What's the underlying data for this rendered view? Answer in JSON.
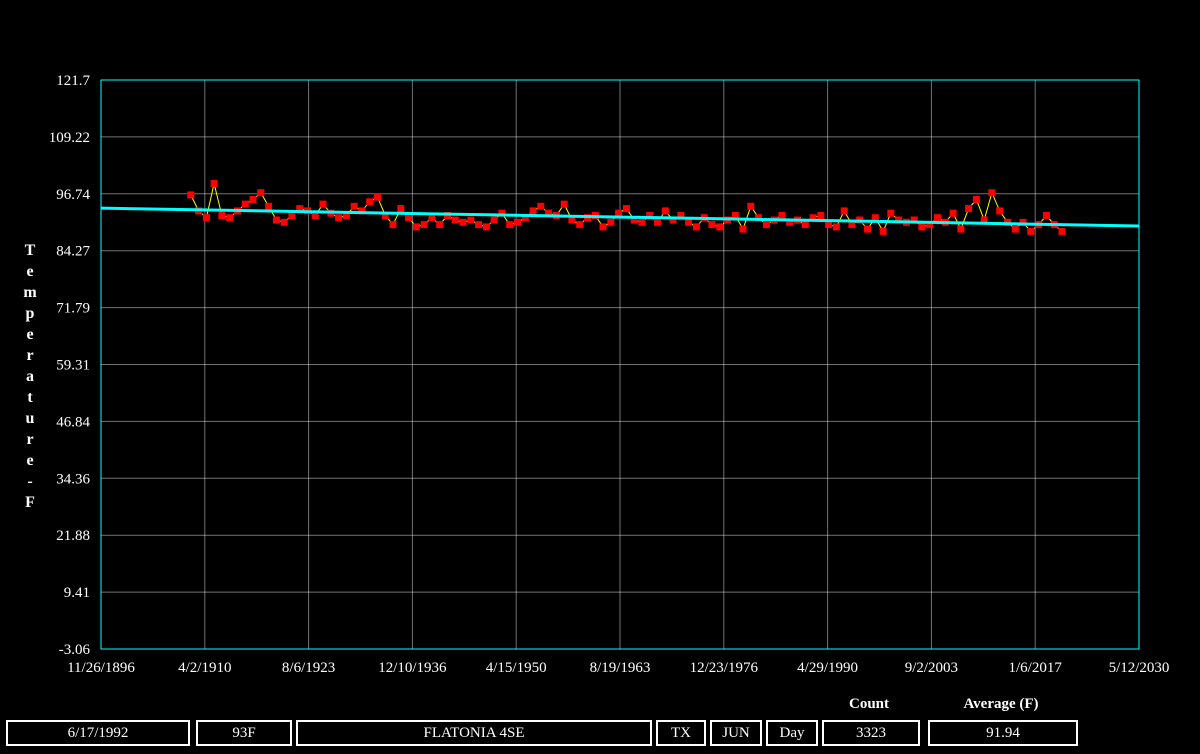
{
  "chart_data": {
    "type": "scatter",
    "title": "",
    "xlabel": "",
    "ylabel": "Temperature - F",
    "ylim": [
      -3.06,
      121.7
    ],
    "y_ticks": [
      "121.7",
      "109.22",
      "96.74",
      "84.27",
      "71.79",
      "59.31",
      "46.84",
      "34.36",
      "21.88",
      "9.41",
      "-3.06"
    ],
    "x_ticks": [
      "11/26/1896",
      "4/2/1910",
      "8/6/1923",
      "12/10/1936",
      "4/15/1950",
      "8/19/1963",
      "12/23/1976",
      "4/29/1990",
      "9/2/2003",
      "1/6/2017",
      "5/12/2030"
    ],
    "xlim": [
      "1896-11-26",
      "2030-05-12"
    ],
    "grid": true,
    "data_range_years": [
      1908,
      2020
    ],
    "colors": {
      "background": "#000000",
      "plot_frame": "#00ffff",
      "grid": "#ffffff",
      "markers": "#ff0000",
      "connector": "#ffff00",
      "trend": "#00ffff",
      "text": "#ffffff"
    },
    "trend": {
      "start": [
        "1896-11-26",
        93.6
      ],
      "end": [
        "2030-05-12",
        89.7
      ]
    },
    "series": [
      {
        "values": [
          [
            1908,
            96.5
          ],
          [
            1909,
            93.0
          ],
          [
            1910,
            91.5
          ],
          [
            1911,
            99.0
          ],
          [
            1912,
            92.0
          ],
          [
            1913,
            91.5
          ],
          [
            1914,
            93.0
          ],
          [
            1915,
            94.5
          ],
          [
            1916,
            95.5
          ],
          [
            1917,
            97.0
          ],
          [
            1918,
            94.0
          ],
          [
            1919,
            91.0
          ],
          [
            1920,
            90.5
          ],
          [
            1921,
            92.0
          ],
          [
            1922,
            93.5
          ],
          [
            1923,
            93.0
          ],
          [
            1924,
            92.0
          ],
          [
            1925,
            94.5
          ],
          [
            1926,
            92.5
          ],
          [
            1927,
            91.5
          ],
          [
            1928,
            92.0
          ],
          [
            1929,
            94.0
          ],
          [
            1930,
            93.0
          ],
          [
            1931,
            95.0
          ],
          [
            1932,
            96.0
          ],
          [
            1933,
            92.0
          ],
          [
            1934,
            90.0
          ],
          [
            1935,
            93.5
          ],
          [
            1936,
            91.5
          ],
          [
            1937,
            89.5
          ],
          [
            1938,
            90.0
          ],
          [
            1939,
            91.5
          ],
          [
            1940,
            90.0
          ],
          [
            1941,
            92.0
          ],
          [
            1942,
            91.0
          ],
          [
            1943,
            90.5
          ],
          [
            1944,
            91.0
          ],
          [
            1945,
            90.0
          ],
          [
            1946,
            89.5
          ],
          [
            1947,
            91.0
          ],
          [
            1948,
            92.5
          ],
          [
            1949,
            90.0
          ],
          [
            1950,
            90.5
          ],
          [
            1951,
            91.5
          ],
          [
            1952,
            93.0
          ],
          [
            1953,
            94.0
          ],
          [
            1954,
            92.5
          ],
          [
            1955,
            92.0
          ],
          [
            1956,
            94.5
          ],
          [
            1957,
            91.0
          ],
          [
            1958,
            90.0
          ],
          [
            1959,
            91.5
          ],
          [
            1960,
            92.0
          ],
          [
            1961,
            89.5
          ],
          [
            1962,
            90.5
          ],
          [
            1963,
            92.5
          ],
          [
            1964,
            93.5
          ],
          [
            1965,
            91.0
          ],
          [
            1966,
            90.5
          ],
          [
            1967,
            92.0
          ],
          [
            1968,
            90.5
          ],
          [
            1969,
            93.0
          ],
          [
            1970,
            91.0
          ],
          [
            1971,
            92.0
          ],
          [
            1972,
            90.5
          ],
          [
            1973,
            89.5
          ],
          [
            1974,
            91.5
          ],
          [
            1975,
            90.0
          ],
          [
            1976,
            89.5
          ],
          [
            1977,
            91.0
          ],
          [
            1978,
            92.0
          ],
          [
            1979,
            89.0
          ],
          [
            1980,
            94.0
          ],
          [
            1981,
            91.5
          ],
          [
            1982,
            90.0
          ],
          [
            1983,
            91.0
          ],
          [
            1984,
            92.0
          ],
          [
            1985,
            90.5
          ],
          [
            1986,
            91.0
          ],
          [
            1987,
            90.0
          ],
          [
            1988,
            91.5
          ],
          [
            1989,
            92.0
          ],
          [
            1990,
            90.0
          ],
          [
            1991,
            89.5
          ],
          [
            1992,
            93.0
          ],
          [
            1993,
            90.0
          ],
          [
            1994,
            91.0
          ],
          [
            1995,
            89.0
          ],
          [
            1996,
            91.5
          ],
          [
            1997,
            88.5
          ],
          [
            1998,
            92.5
          ],
          [
            1999,
            91.0
          ],
          [
            2000,
            90.5
          ],
          [
            2001,
            91.0
          ],
          [
            2002,
            89.5
          ],
          [
            2003,
            90.0
          ],
          [
            2004,
            91.5
          ],
          [
            2005,
            90.5
          ],
          [
            2006,
            92.5
          ],
          [
            2007,
            89.0
          ],
          [
            2008,
            93.5
          ],
          [
            2009,
            95.5
          ],
          [
            2010,
            91.0
          ],
          [
            2011,
            97.0
          ],
          [
            2012,
            93.0
          ],
          [
            2013,
            90.5
          ],
          [
            2014,
            89.0
          ],
          [
            2015,
            90.5
          ],
          [
            2016,
            88.5
          ],
          [
            2017,
            90.0
          ],
          [
            2018,
            92.0
          ],
          [
            2019,
            90.0
          ],
          [
            2020,
            88.5
          ]
        ]
      }
    ]
  },
  "status": {
    "date": "6/17/1992",
    "temp": "93F",
    "station": "FLATONIA 4SE",
    "state": "TX",
    "month": "JUN",
    "period": "Day",
    "count_label": "Count",
    "count": "3323",
    "average_label": "Average (F)",
    "average": "91.94"
  }
}
